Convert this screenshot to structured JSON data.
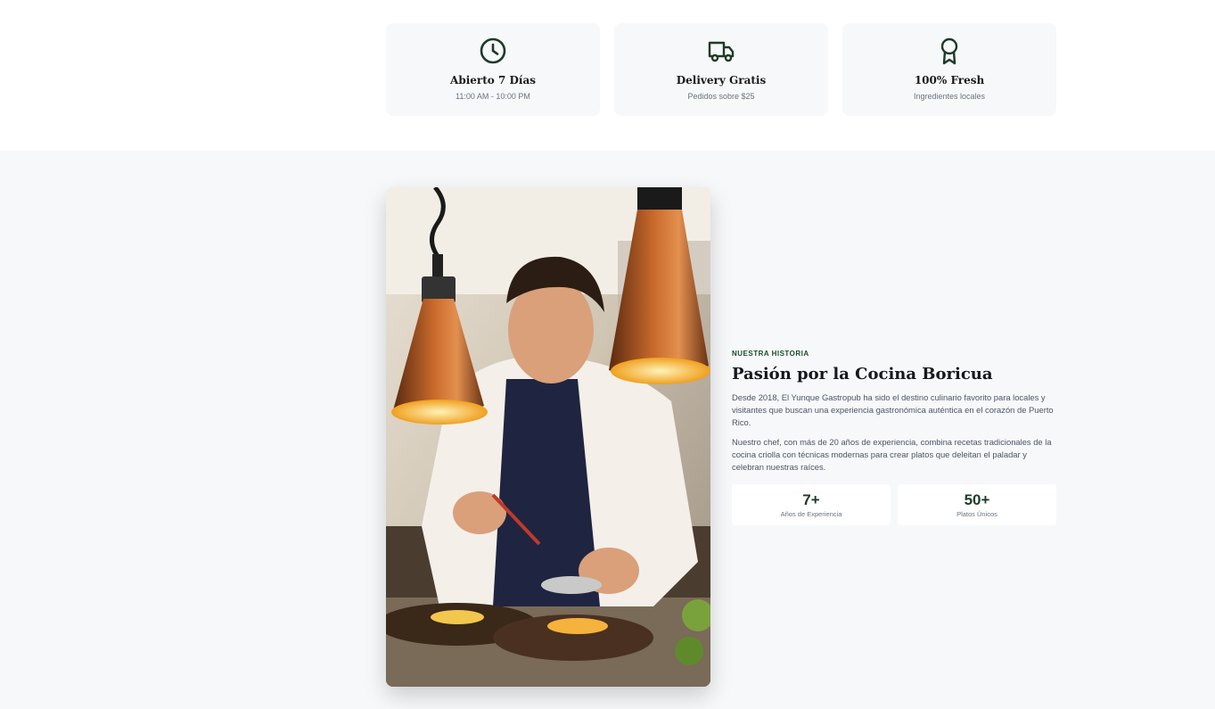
{
  "features": [
    {
      "icon": "clock-icon",
      "title": "Abierto 7 Días",
      "subtitle": "11:00 AM - 10:00 PM"
    },
    {
      "icon": "truck-icon",
      "title": "Delivery Gratis",
      "subtitle": "Pedidos sobre $25"
    },
    {
      "icon": "award-icon",
      "title": "100% Fresh",
      "subtitle": "Ingredientes locales"
    }
  ],
  "story": {
    "eyebrow": "NUESTRA HISTORIA",
    "heading": "Pasión por la Cocina Boricua",
    "paragraph1": "Desde 2018, El Yunque Gastropub ha sido el destino culinario favorito para locales y visitantes que buscan una experiencia gastronómica auténtica en el corazón de Puerto Rico.",
    "paragraph2": "Nuestro chef, con más de 20 años de experiencia, combina recetas tradicionales de la cocina criolla con técnicas modernas para crear platos que deleitan el paladar y celebran nuestras raíces.",
    "stats": [
      {
        "value": "7+",
        "label": "Años de Experiencia"
      },
      {
        "value": "50+",
        "label": "Platos Únicos"
      }
    ]
  },
  "colors": {
    "brand_green": "#1d3b26",
    "section_bg": "#f7f8fa",
    "card_bg": "#f7f8fa"
  }
}
